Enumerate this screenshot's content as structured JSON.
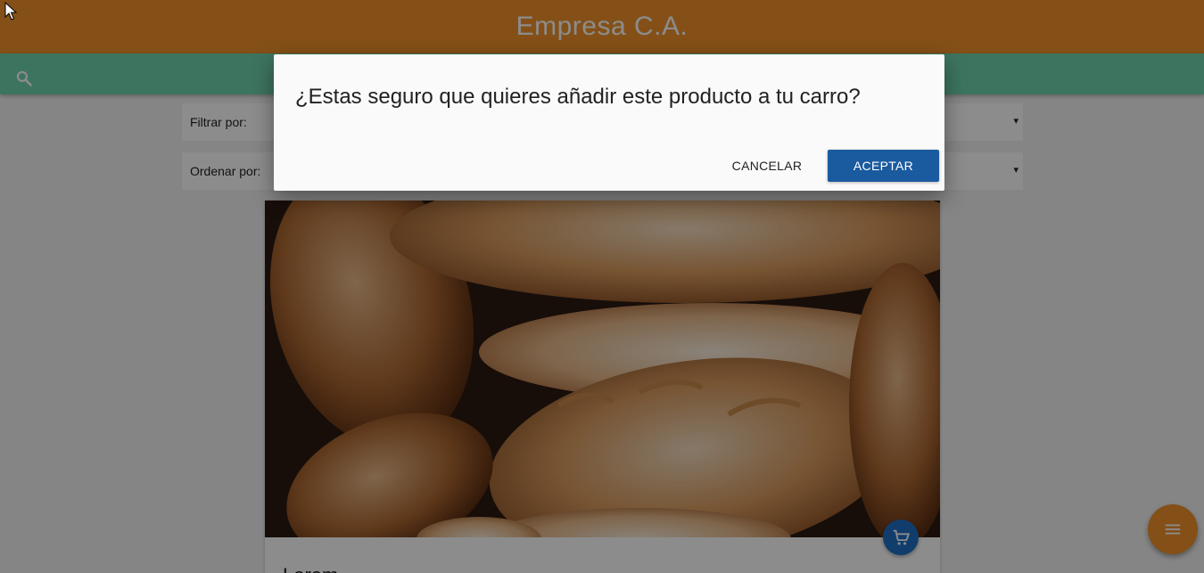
{
  "header": {
    "title": "Empresa C.A."
  },
  "search": {
    "icon": "search-icon"
  },
  "filters": {
    "filter_label": "Filtrar por:",
    "order_label": "Ordenar por:",
    "arrow": "▾"
  },
  "product": {
    "name": "Lorem",
    "cart_icon": "cart-icon"
  },
  "fab": {
    "icon": "menu-icon"
  },
  "dialog": {
    "message": "¿Estas seguro que quieres añadir este producto a tu carro?",
    "cancel_label": "CANCELAR",
    "accept_label": "ACEPTAR"
  },
  "colors": {
    "header": "#f0932b",
    "searchbar": "#6fd3b0",
    "accept": "#1a5ba0",
    "cart_button": "#1f6fc5"
  }
}
